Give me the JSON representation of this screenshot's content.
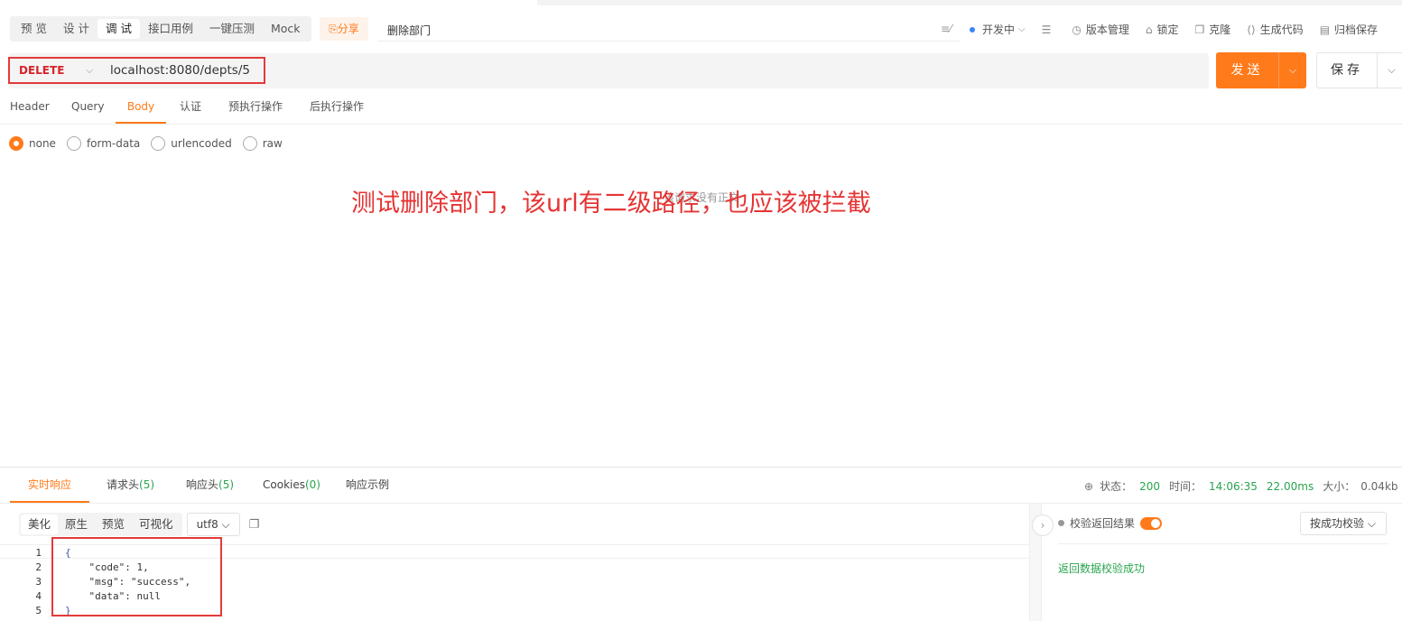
{
  "modes": [
    "预 览",
    "设 计",
    "调 试",
    "接口用例",
    "一键压测",
    "Mock"
  ],
  "active_mode": "调 试",
  "share_label": "⎘分享",
  "api_name": "删除部门",
  "toolbar": {
    "status": "开发中",
    "status_caret": "⌵",
    "version": "版本管理",
    "lock": "锁定",
    "clone": "克隆",
    "gencode": "生成代码",
    "archive": "归档保存"
  },
  "request": {
    "method": "DELETE",
    "method_caret": "⌵",
    "url": "localhost:8080/depts/5",
    "send_label": "发送",
    "save_label": "保存",
    "dropdown_glyph": "⌵"
  },
  "req_tabs": [
    "Header",
    "Query",
    "Body",
    "认证",
    "预执行操作",
    "后执行操作"
  ],
  "active_req_tab": "Body",
  "body_types": [
    "none",
    "form-data",
    "urlencoded",
    "raw"
  ],
  "selected_body_type": "none",
  "empty_body_text": "该请求没有正文",
  "annotation": "测试删除部门，该url有二级路径，也应该被拦截",
  "resp_tabs": [
    {
      "label": "实时响应",
      "count": ""
    },
    {
      "label": "请求头",
      "count": "(5)"
    },
    {
      "label": "响应头",
      "count": "(5)"
    },
    {
      "label": "Cookies",
      "count": "(0)"
    },
    {
      "label": "响应示例",
      "count": ""
    }
  ],
  "stats": {
    "status_label": "状态：",
    "status": "200",
    "time_label": "时间：",
    "timestamp": "14:06:35",
    "duration": "22.00ms",
    "size_label": "大小：",
    "size": "0.04kb"
  },
  "formats": [
    "美化",
    "原生",
    "预览",
    "可视化"
  ],
  "active_format": "美化",
  "encoding": "utf8 ⌵",
  "code_lines": [
    {
      "n": "1",
      "text": "{"
    },
    {
      "n": "2",
      "text": "    \"code\": 1,"
    },
    {
      "n": "3",
      "text": "    \"msg\": \"success\","
    },
    {
      "n": "4",
      "text": "    \"data\": null"
    },
    {
      "n": "5",
      "text": "}"
    }
  ],
  "verify": {
    "label": "校验返回结果",
    "mode": "按成功校验 ⌵",
    "result": "返回数据校验成功"
  },
  "colors": {
    "accent": "#ff7a1a",
    "method": "#d8222a",
    "success": "#2aa44f",
    "annotation": "#e53434"
  }
}
